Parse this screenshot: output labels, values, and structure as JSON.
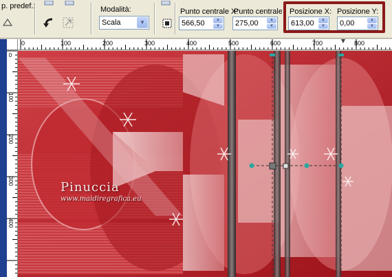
{
  "toolbar": {
    "preset_label": "p. predef.:",
    "mode_label": "Modalità:",
    "mode_value": "Scala",
    "center_x_label": "Punto centrale X:",
    "center_x_value": "566,50",
    "center_y_label": "Punto centrale Y:",
    "center_y_value": "275,00",
    "pos_x_label": "Posizione X:",
    "pos_x_value": "613,00",
    "pos_y_label": "Posizione Y:",
    "pos_y_value": "0,00",
    "highlight_color": "#8b1a1a"
  },
  "ruler_top": {
    "labels": [
      "0",
      "100",
      "200",
      "300",
      "400",
      "500",
      "600",
      "700",
      "800"
    ]
  },
  "ruler_left": {
    "labels": [
      "0",
      "100",
      "200",
      "300",
      "400"
    ]
  },
  "watermark": {
    "name": "Pinuccia",
    "url": "www.maidiregrafica.eu"
  },
  "colors": {
    "canvas_red": "#b31b22",
    "canvas_light": "#f3dcdc",
    "handle_teal": "#2aa7a0"
  },
  "icons": {
    "undo": "undo-arrow-icon",
    "reset": "reset-icon",
    "fit": "fit-canvas-icon"
  }
}
